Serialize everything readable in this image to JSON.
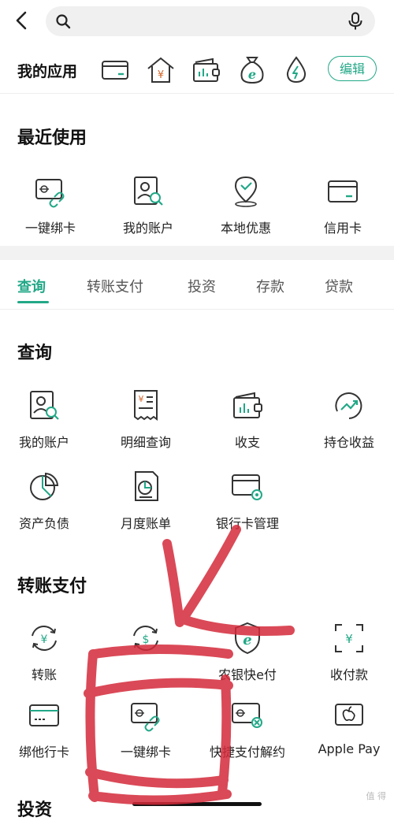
{
  "colors": {
    "accent": "#22a887",
    "annotation": "#d42a3a"
  },
  "search": {
    "placeholder": ""
  },
  "my_apps": {
    "label": "我的应用",
    "icons": [
      "card-icon",
      "house-yen-icon",
      "wallet-chart-icon",
      "money-bag-e-icon",
      "water-drop-bolt-icon"
    ],
    "edit_label": "编辑"
  },
  "recent": {
    "title": "最近使用",
    "items": [
      {
        "label": "一键绑卡",
        "icon": "card-link-icon"
      },
      {
        "label": "我的账户",
        "icon": "account-search-icon"
      },
      {
        "label": "本地优惠",
        "icon": "location-pin-icon"
      },
      {
        "label": "信用卡",
        "icon": "credit-card-icon"
      }
    ]
  },
  "tabs": [
    {
      "label": "查询",
      "active": true
    },
    {
      "label": "转账支付"
    },
    {
      "label": "投资"
    },
    {
      "label": "存款"
    },
    {
      "label": "贷款"
    }
  ],
  "query": {
    "title": "查询",
    "items": [
      {
        "label": "我的账户",
        "icon": "account-search-icon"
      },
      {
        "label": "明细查询",
        "icon": "receipt-yen-icon"
      },
      {
        "label": "收支",
        "icon": "wallet-chart-icon"
      },
      {
        "label": "持仓收益",
        "icon": "trend-up-icon"
      },
      {
        "label": "资产负债",
        "icon": "pie-chart-icon"
      },
      {
        "label": "月度账单",
        "icon": "bill-chart-icon"
      },
      {
        "label": "银行卡管理",
        "icon": "card-gear-icon"
      }
    ]
  },
  "transfer": {
    "title": "转账支付",
    "items": [
      {
        "label": "转账",
        "icon": "yen-cycle-icon"
      },
      {
        "label": "",
        "icon": "dollar-cycle-icon"
      },
      {
        "label": "农银快e付",
        "icon": "shield-e-icon"
      },
      {
        "label": "收付款",
        "icon": "scan-yen-icon"
      },
      {
        "label": "绑他行卡",
        "icon": "card-dashed-icon"
      },
      {
        "label": "一键绑卡",
        "icon": "card-link-icon"
      },
      {
        "label": "快捷支付解约",
        "icon": "card-cancel-icon"
      },
      {
        "label": "Apple Pay",
        "icon": "apple-icon"
      }
    ]
  },
  "next_section_peek": "投资",
  "watermark": "值 得"
}
